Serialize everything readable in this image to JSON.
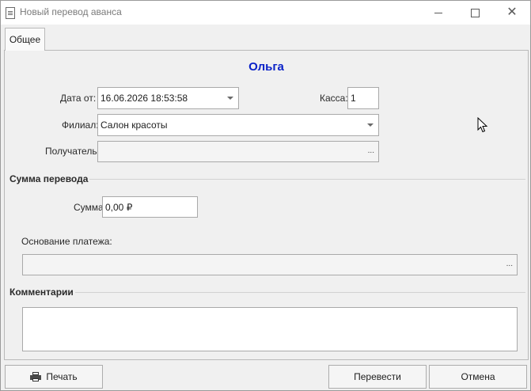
{
  "window": {
    "title": "Новый перевод аванса",
    "icon": "document-icon",
    "controls": {
      "minimize": "minimize-icon",
      "maximize": "maximize-icon",
      "close": "close-icon"
    }
  },
  "tabs": [
    {
      "label": "Общее",
      "active": true
    }
  ],
  "client_name": "Ольга",
  "form": {
    "date_label": "Дата от:",
    "date_value": "16.06.2026 18:53:58",
    "cash_label": "Касса:",
    "cash_value": "1",
    "branch_label": "Филиал:",
    "branch_value": "Салон красоты",
    "recipient_label": "Получатель:",
    "recipient_value": "",
    "recipient_ellipsis": "...",
    "transfer_section": "Сумма перевода",
    "amount_label": "Сумма:",
    "amount_value": "0,00 ₽",
    "basis_label": "Основание платежа:",
    "basis_value": "",
    "basis_ellipsis": "...",
    "comments_section": "Комментарии",
    "comments_value": ""
  },
  "buttons": {
    "print": "Печать",
    "transfer": "Перевести",
    "cancel": "Отмена"
  },
  "colors": {
    "client_name": "#0a22c8"
  }
}
